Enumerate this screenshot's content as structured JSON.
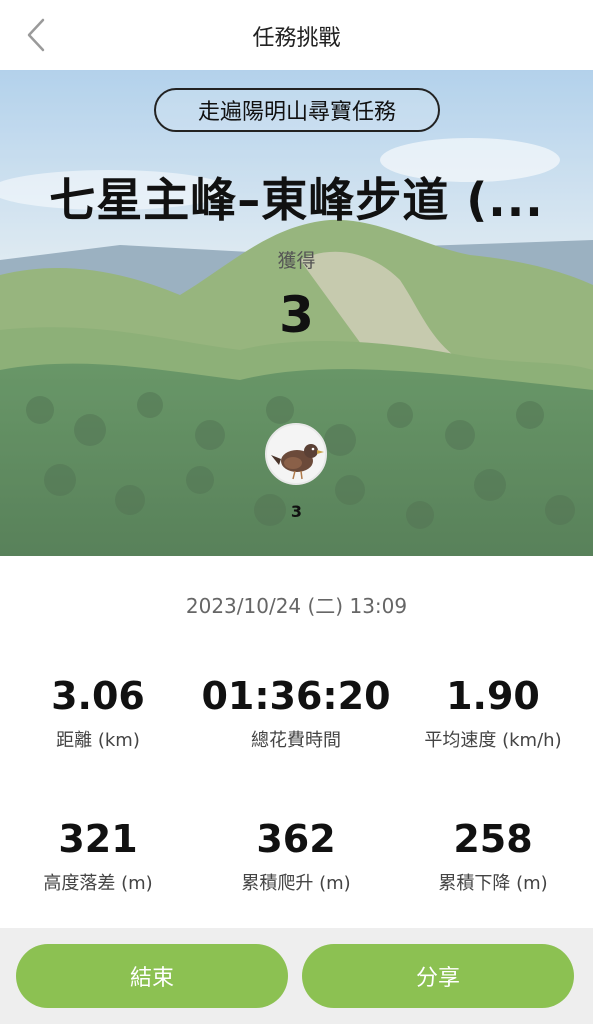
{
  "header": {
    "title": "任務挑戰"
  },
  "hero": {
    "mission_name": "走遍陽明山尋寶任務",
    "trail_name": "七星主峰–東峰步道 (...",
    "gain_label": "獲得",
    "gain_count": "3",
    "badge_count": "3"
  },
  "datetime": "2023/10/24 (二) 13:09",
  "stats": [
    {
      "value": "3.06",
      "label": "距離 (km)"
    },
    {
      "value": "01:36:20",
      "label": "總花費時間"
    },
    {
      "value": "1.90",
      "label": "平均速度 (km/h)"
    },
    {
      "value": "321",
      "label": "高度落差 (m)"
    },
    {
      "value": "362",
      "label": "累積爬升 (m)"
    },
    {
      "value": "258",
      "label": "累積下降 (m)"
    }
  ],
  "buttons": {
    "end_label": "結束",
    "share_label": "分享"
  },
  "colors": {
    "accent": "#8cc152",
    "footer_bg": "#eeeeee"
  },
  "icons": {
    "back": "chevron-left-icon",
    "badge": "bird-icon"
  }
}
